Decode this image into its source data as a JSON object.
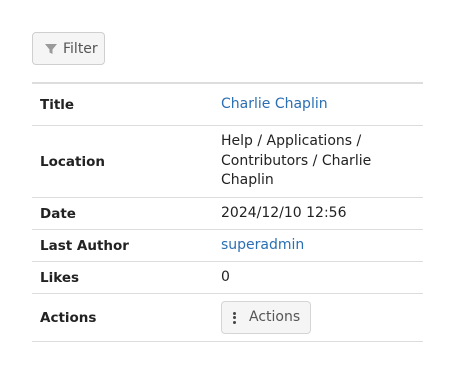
{
  "filter": {
    "label": "Filter",
    "icon": "filter-icon"
  },
  "details": {
    "title": {
      "key": "Title",
      "value": "Charlie Chaplin"
    },
    "location": {
      "key": "Location",
      "value_lines": [
        "Help / Applications /",
        "Contributors / Charlie",
        "Chaplin"
      ]
    },
    "date": {
      "key": "Date",
      "value": "2024/12/10 12:56"
    },
    "last_author": {
      "key": "Last Author",
      "value": "superadmin"
    },
    "likes": {
      "key": "Likes",
      "value": "0"
    },
    "actions": {
      "key": "Actions",
      "button_label": "Actions",
      "icon": "more-vertical-icon"
    }
  },
  "colors": {
    "link": "#2a6fb3",
    "border": "#dddddd",
    "button_bg": "#f5f5f5"
  }
}
